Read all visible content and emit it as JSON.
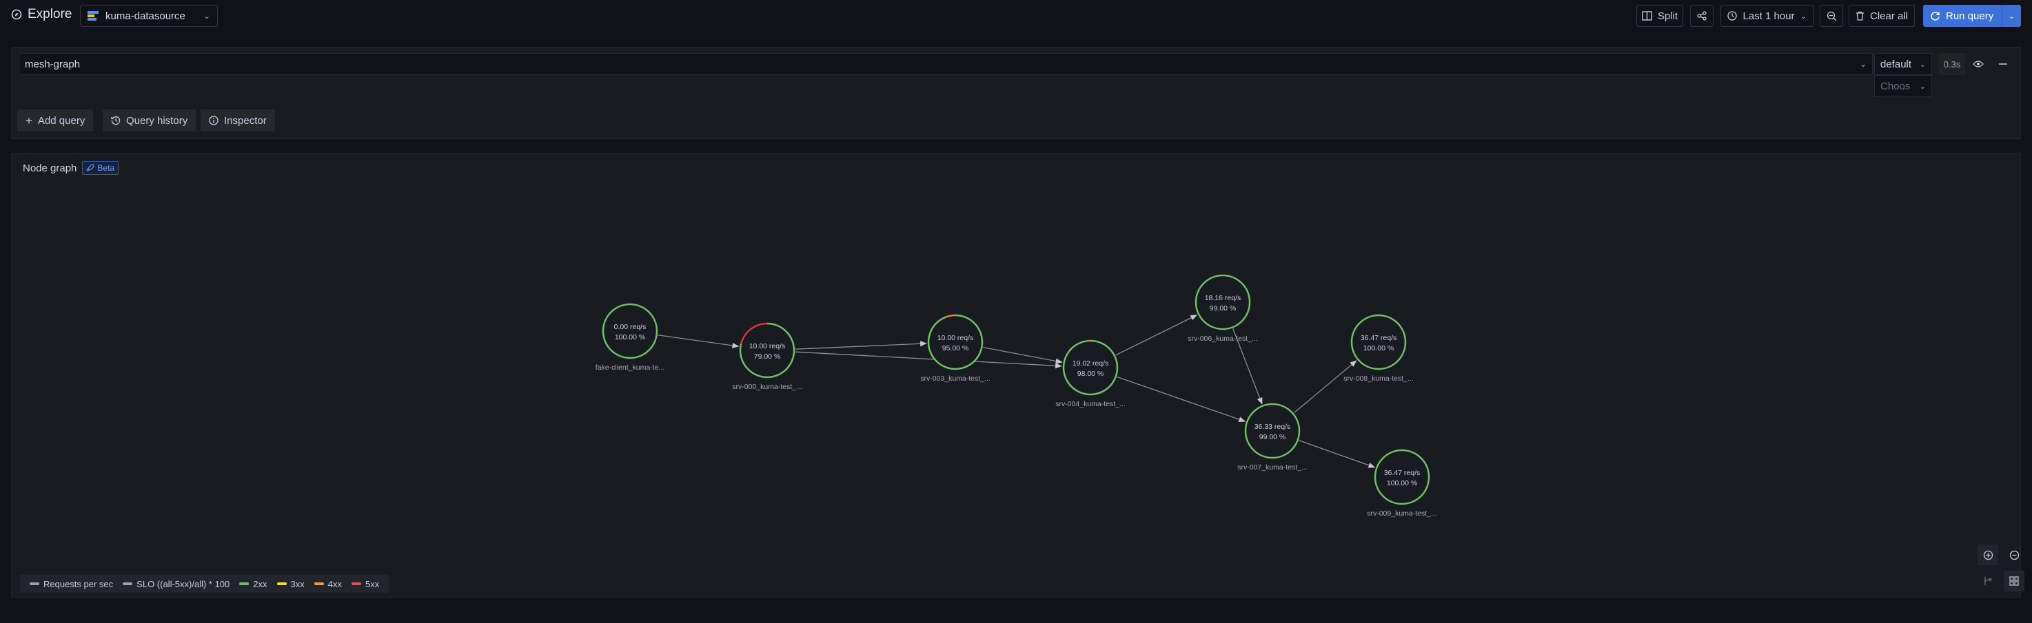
{
  "header": {
    "title": "Explore",
    "datasource": "kuma-datasource",
    "split_label": "Split",
    "time_range": "Last 1 hour",
    "clear_label": "Clear all",
    "run_label": "Run query"
  },
  "query": {
    "value": "mesh-graph",
    "select_value": "default",
    "choose_placeholder": "Choose",
    "time": "0.3s",
    "add_query": "Add query",
    "history": "Query history",
    "inspector": "Inspector"
  },
  "panel": {
    "title": "Node graph",
    "badge": "Beta"
  },
  "nodes": [
    {
      "id": "fake",
      "rate": "0.00 req/s",
      "slo": "100.00 %",
      "label": "fake-client_kuma-te...",
      "arcs": []
    },
    {
      "id": "srv000",
      "rate": "10.00 req/s",
      "slo": "79.00 %",
      "label": "srv-000_kuma-test_...",
      "arcs": [
        {
          "color": "#e02f44",
          "fraction": 0.21
        }
      ]
    },
    {
      "id": "srv003",
      "rate": "10.00 req/s",
      "slo": "95.00 %",
      "label": "srv-003_kuma-test_...",
      "arcs": [
        {
          "color": "#ff7a29",
          "fraction": 0.05
        }
      ]
    },
    {
      "id": "srv004",
      "rate": "19.02 req/s",
      "slo": "98.00 %",
      "label": "srv-004_kuma-test_...",
      "arcs": [
        {
          "color": "#ff7a29",
          "fraction": 0.02
        }
      ]
    },
    {
      "id": "srv006",
      "rate": "18.16 req/s",
      "slo": "99.00 %",
      "label": "srv-006_kuma-test_...",
      "arcs": []
    },
    {
      "id": "srv007",
      "rate": "36.33 req/s",
      "slo": "99.00 %",
      "label": "srv-007_kuma-test_...",
      "arcs": []
    },
    {
      "id": "srv008",
      "rate": "36.47 req/s",
      "slo": "100.00 %",
      "label": "srv-008_kuma-test_...",
      "arcs": []
    },
    {
      "id": "srv009",
      "rate": "36.47 req/s",
      "slo": "100.00 %",
      "label": "srv-009_kuma-test_...",
      "arcs": []
    }
  ],
  "edges": [
    {
      "from": "fake",
      "to": "srv000"
    },
    {
      "from": "srv000",
      "to": "srv003"
    },
    {
      "from": "srv000",
      "to": "srv004"
    },
    {
      "from": "srv003",
      "to": "srv004"
    },
    {
      "from": "srv004",
      "to": "srv006"
    },
    {
      "from": "srv004",
      "to": "srv007"
    },
    {
      "from": "srv006",
      "to": "srv007"
    },
    {
      "from": "srv007",
      "to": "srv008"
    },
    {
      "from": "srv007",
      "to": "srv009"
    }
  ],
  "legend": [
    {
      "label": "Requests per sec",
      "color": "#9fa0aa"
    },
    {
      "label": "SLO ((all-5xx)/all) * 100",
      "color": "#9fa0aa"
    },
    {
      "label": "2xx",
      "color": "#73bf69"
    },
    {
      "label": "3xx",
      "color": "#fade2a"
    },
    {
      "label": "4xx",
      "color": "#ff9830"
    },
    {
      "label": "5xx",
      "color": "#f2495c"
    }
  ],
  "colors": {
    "accent": "#3d71d9",
    "node_ok": "#73bf69",
    "edge": "#8e8e95"
  }
}
